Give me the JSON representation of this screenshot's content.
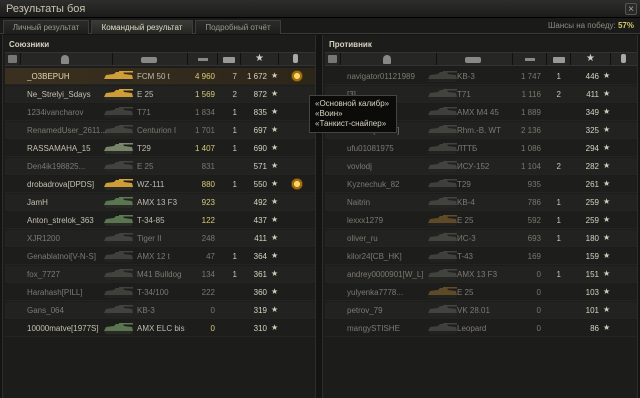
{
  "window": {
    "title": "Результаты боя",
    "close_glyph": "×"
  },
  "tabs": [
    {
      "label": "Личный результат",
      "active": false
    },
    {
      "label": "Командный результат",
      "active": true
    },
    {
      "label": "Подробный отчёт",
      "active": false
    }
  ],
  "win_chance": {
    "label": "Шансы на победу:",
    "value": "57%"
  },
  "colors": {
    "gold": "#d8b040",
    "grey_tank": "#6e6e66",
    "green_tank": "#5e7a52",
    "accent": "#d8c76a"
  },
  "tooltip": {
    "lines": [
      "«Основной калибр»",
      "«Воин»",
      "«Танкист-снайпер»"
    ]
  },
  "allies": {
    "title": "Союзники",
    "players": [
      {
        "name": "_O3BEPUH",
        "vehicle": "FCM 50 t",
        "damage": "4 960",
        "frags": "7",
        "xp": "1 672",
        "alive": true,
        "me": true,
        "medal": true,
        "tank_color": "#d8a43a"
      },
      {
        "name": "Ne_Strelyi_Sdays",
        "vehicle": "E 25",
        "damage": "1 569",
        "frags": "2",
        "xp": "872",
        "alive": true,
        "me": false,
        "medal": false,
        "tank_color": "#d8a43a"
      },
      {
        "name": "1234ivancharov",
        "vehicle": "T71",
        "damage": "1 834",
        "frags": "1",
        "xp": "835",
        "alive": false,
        "me": false,
        "medal": false,
        "tank_color": "#6e6e66"
      },
      {
        "name": "RenamedUser_2611...",
        "vehicle": "Centurion I",
        "damage": "1 701",
        "frags": "1",
        "xp": "697",
        "alive": false,
        "me": false,
        "medal": false,
        "tank_color": "#6e6e66"
      },
      {
        "name": "RASSAMAHA_15",
        "vehicle": "T29",
        "damage": "1 407",
        "frags": "1",
        "xp": "690",
        "alive": true,
        "me": false,
        "medal": false,
        "tank_color": "#7c8a6e"
      },
      {
        "name": "Den4ik198825...",
        "vehicle": "E 25",
        "damage": "831",
        "frags": "",
        "xp": "571",
        "alive": false,
        "me": false,
        "medal": false,
        "tank_color": "#6e6e66"
      },
      {
        "name": "drobadrova[DPDS]",
        "vehicle": "WZ-111",
        "damage": "880",
        "frags": "1",
        "xp": "550",
        "alive": true,
        "me": false,
        "medal": true,
        "tank_color": "#d8a43a"
      },
      {
        "name": "JamH",
        "vehicle": "AMX 13 F3",
        "damage": "923",
        "frags": "",
        "xp": "492",
        "alive": true,
        "me": false,
        "medal": false,
        "tank_color": "#5e7a52"
      },
      {
        "name": "Anton_strelok_363",
        "vehicle": "T-34-85",
        "damage": "122",
        "frags": "",
        "xp": "437",
        "alive": true,
        "me": false,
        "medal": false,
        "tank_color": "#5e7a52"
      },
      {
        "name": "XJR1200",
        "vehicle": "Tiger II",
        "damage": "248",
        "frags": "",
        "xp": "411",
        "alive": false,
        "me": false,
        "medal": false,
        "tank_color": "#6e6e66"
      },
      {
        "name": "Genablatnoi[V-N-S]",
        "vehicle": "AMX 12 t",
        "damage": "47",
        "frags": "1",
        "xp": "364",
        "alive": false,
        "me": false,
        "medal": false,
        "tank_color": "#6e6e66"
      },
      {
        "name": "fox_7727",
        "vehicle": "M41 Bulldog",
        "damage": "134",
        "frags": "1",
        "xp": "361",
        "alive": false,
        "me": false,
        "medal": false,
        "tank_color": "#6e6e66"
      },
      {
        "name": "Harahash[PILL]",
        "vehicle": "T-34/100",
        "damage": "222",
        "frags": "",
        "xp": "360",
        "alive": false,
        "me": false,
        "medal": false,
        "tank_color": "#6e6e66"
      },
      {
        "name": "Gans_064",
        "vehicle": "KB-3",
        "damage": "0",
        "frags": "",
        "xp": "319",
        "alive": false,
        "me": false,
        "medal": false,
        "tank_color": "#6e6e66"
      },
      {
        "name": "10000matve[1977S]",
        "vehicle": "AMX ELC bis",
        "damage": "0",
        "frags": "",
        "xp": "310",
        "alive": true,
        "me": false,
        "medal": false,
        "tank_color": "#5e7a52"
      }
    ]
  },
  "enemies": {
    "title": "Противник",
    "players": [
      {
        "name": "navigator01121989",
        "vehicle": "KB-3",
        "damage": "1 747",
        "frags": "1",
        "xp": "446",
        "alive": false,
        "tank_color": "#6e6e66"
      },
      {
        "name": "[3]",
        "vehicle": "T71",
        "damage": "1 116",
        "frags": "2",
        "xp": "411",
        "alive": false,
        "tank_color": "#6e6e66"
      },
      {
        "name": "",
        "vehicle": "AMX M4 45",
        "damage": "1 889",
        "frags": "",
        "xp": "349",
        "alive": false,
        "tank_color": "#6e6e66"
      },
      {
        "name": "304011[VNBK]",
        "vehicle": "Rhm.-B. WT",
        "damage": "2 136",
        "frags": "",
        "xp": "325",
        "alive": false,
        "tank_color": "#6e6e66"
      },
      {
        "name": "ufu01081975",
        "vehicle": "ЛТТБ",
        "damage": "1 086",
        "frags": "",
        "xp": "294",
        "alive": false,
        "tank_color": "#6e6e66"
      },
      {
        "name": "vovlodj",
        "vehicle": "ИСУ-152",
        "damage": "1 104",
        "frags": "2",
        "xp": "282",
        "alive": false,
        "tank_color": "#6e6e66"
      },
      {
        "name": "Kyznechuk_82",
        "vehicle": "T29",
        "damage": "935",
        "frags": "",
        "xp": "261",
        "alive": false,
        "tank_color": "#6e6e66"
      },
      {
        "name": "Naitrin",
        "vehicle": "KB-4",
        "damage": "786",
        "frags": "1",
        "xp": "259",
        "alive": false,
        "tank_color": "#6e6e66"
      },
      {
        "name": "lexxx1279",
        "vehicle": "E 25",
        "damage": "592",
        "frags": "1",
        "xp": "259",
        "alive": false,
        "tank_color": "#b88838"
      },
      {
        "name": "oliver_ru",
        "vehicle": "ИС-3",
        "damage": "693",
        "frags": "1",
        "xp": "180",
        "alive": false,
        "tank_color": "#6e6e66"
      },
      {
        "name": "kilor24[CB_HK]",
        "vehicle": "T-43",
        "damage": "169",
        "frags": "",
        "xp": "159",
        "alive": false,
        "tank_color": "#6e6e66"
      },
      {
        "name": "andrey0000901[W_L]",
        "vehicle": "AMX 13 F3",
        "damage": "0",
        "frags": "1",
        "xp": "151",
        "alive": false,
        "tank_color": "#6e6e66"
      },
      {
        "name": "yulyenka7778...",
        "vehicle": "E 25",
        "damage": "0",
        "frags": "",
        "xp": "103",
        "alive": false,
        "tank_color": "#b88838"
      },
      {
        "name": "petrov_79",
        "vehicle": "VK 28.01",
        "damage": "0",
        "frags": "",
        "xp": "101",
        "alive": false,
        "tank_color": "#6e6e66"
      },
      {
        "name": "mangySTISHE",
        "vehicle": "Leopard",
        "damage": "0",
        "frags": "",
        "xp": "86",
        "alive": false,
        "tank_color": "#6e6e66"
      }
    ]
  }
}
